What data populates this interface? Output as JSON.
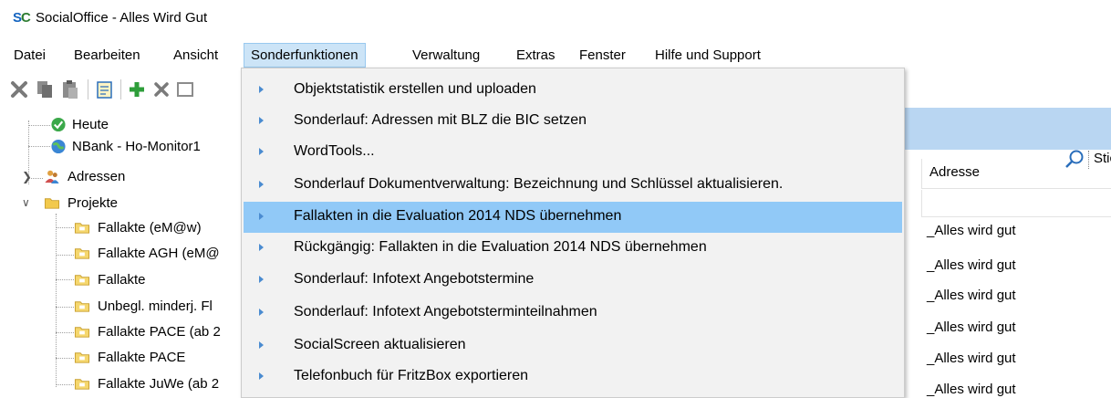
{
  "window": {
    "logo": "SC",
    "title": "SocialOffice - Alles Wird Gut"
  },
  "menubar": {
    "items": [
      "Datei",
      "Bearbeiten",
      "Ansicht",
      "Sonderfunktionen",
      "Verwaltung",
      "Extras",
      "Fenster",
      "Hilfe und Support"
    ],
    "active": "Sonderfunktionen"
  },
  "toolbar": {
    "search_label": "Stich"
  },
  "tree": {
    "items": [
      "Heute",
      "NBank - Ho-Monitor1",
      "Adressen",
      "Projekte",
      "Fallakte (eM@w)",
      "Fallakte AGH (eM@",
      "Fallakte",
      "Unbegl. minderj. Fl",
      "Fallakte PACE (ab 2",
      "Fallakte PACE",
      "Fallakte JuWe (ab 2"
    ]
  },
  "grid": {
    "column_header": "Adresse",
    "cells": [
      "_Alles wird gut",
      "_Alles wird gut",
      "_Alles wird gut",
      "_Alles wird gut",
      "_Alles wird gut",
      "_Alles wird gut"
    ]
  },
  "dropdown": {
    "items": [
      "Objektstatistik erstellen und uploaden",
      "Sonderlauf: Adressen mit BLZ die BIC setzen",
      "WordTools...",
      "Sonderlauf Dokumentverwaltung: Bezeichnung und Schlüssel aktualisieren.",
      "Fallakten in die Evaluation 2014 NDS übernehmen",
      "Rückgängig: Fallakten in die Evaluation 2014 NDS übernehmen",
      "Sonderlauf: Infotext Angebotstermine",
      "Sonderlauf: Infotext Angebotsterminteilnahmen",
      "SocialScreen aktualisieren",
      "Telefonbuch für FritzBox exportieren"
    ],
    "highlighted_index": 4
  },
  "colors": {
    "menu_active_bg": "#cce4f7",
    "highlight_bg": "#91c9f7",
    "band_bg": "#b9d6f2"
  }
}
